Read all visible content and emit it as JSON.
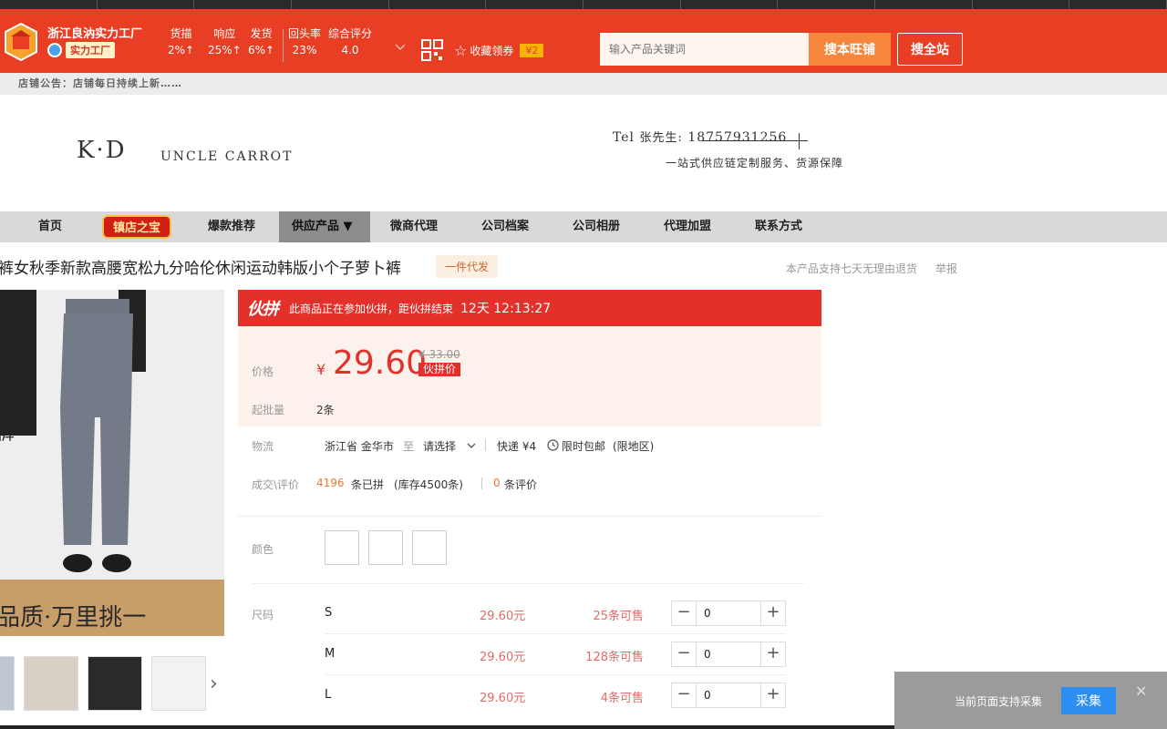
{
  "shop": {
    "name": "浙江良汭实力工厂",
    "tag": "实力工厂",
    "stats": [
      {
        "label": "货描",
        "value": "2%↑"
      },
      {
        "label": "响应",
        "value": "25%↑"
      },
      {
        "label": "发货",
        "value": "6%↑"
      },
      {
        "label": "回头率",
        "value": "23%"
      },
      {
        "label": "综合评分",
        "value": "4.0"
      }
    ],
    "favorite": "收藏领券",
    "coupon": "¥2"
  },
  "search": {
    "placeholder": "输入产品关键词",
    "btn_shop": "搜本旺铺",
    "btn_all": "搜全站"
  },
  "notice": "店铺公告：店铺每日持续上新……",
  "banner": {
    "brand": "K·D",
    "subbrand": "UNCLE  CARROT",
    "tel_label": "Tel",
    "tel_name": "张先生:",
    "tel_number": "18757931256",
    "slogan": "一站式供应链定制服务、货源保障"
  },
  "nav": {
    "items": [
      "首页",
      "镇店之宝",
      "爆款推荐",
      "供应产品 ▼",
      "微商代理",
      "公司档案",
      "公司相册",
      "代理加盟",
      "联系方式"
    ]
  },
  "product": {
    "title": "裤女秋季新款高腰宽松九分哈伦休闲运动韩版小个子萝卜裤",
    "dropship": "一件代发",
    "return_policy": "本产品支持七天无理由退货",
    "report": "举报",
    "image_text": "品质·万里挑一",
    "image_side_text": "裤"
  },
  "group": {
    "logo": "伙拼",
    "text": "此商品正在参加伙拼，距伙拼结束",
    "timer": "12天 12:13:27"
  },
  "price": {
    "label": "价格",
    "yen": "¥",
    "value": "29.60",
    "original": "¥ 33.00",
    "tag": "伙拼价",
    "moq_label": "起批量",
    "moq": "2条"
  },
  "logistics": {
    "label": "物流",
    "from": "浙江省 金华市",
    "to_label": "至",
    "select": "请选择",
    "express": "快递 ¥4",
    "free_ship": "限时包邮",
    "region": "(限地区)"
  },
  "sales": {
    "label": "成交\\评价",
    "count": "4196",
    "count_suffix": "条已拼",
    "stock": "(库存4500条)",
    "reviews": "0",
    "reviews_suffix": "条评价"
  },
  "options": {
    "color_label": "颜色",
    "size_label": "尺码",
    "sizes": [
      {
        "name": "S",
        "price": "29.60元",
        "stock": "25条可售",
        "qty": "0"
      },
      {
        "name": "M",
        "price": "29.60元",
        "stock": "128条可售",
        "qty": "0"
      },
      {
        "name": "L",
        "price": "29.60元",
        "stock": "4条可售",
        "qty": "0"
      }
    ]
  },
  "collect": {
    "text": "当前页面支持采集",
    "button": "采集"
  },
  "colors": {
    "shop_red": "#e83e23",
    "price_red": "#e2312b",
    "collect_blue": "#2b8ef0"
  }
}
